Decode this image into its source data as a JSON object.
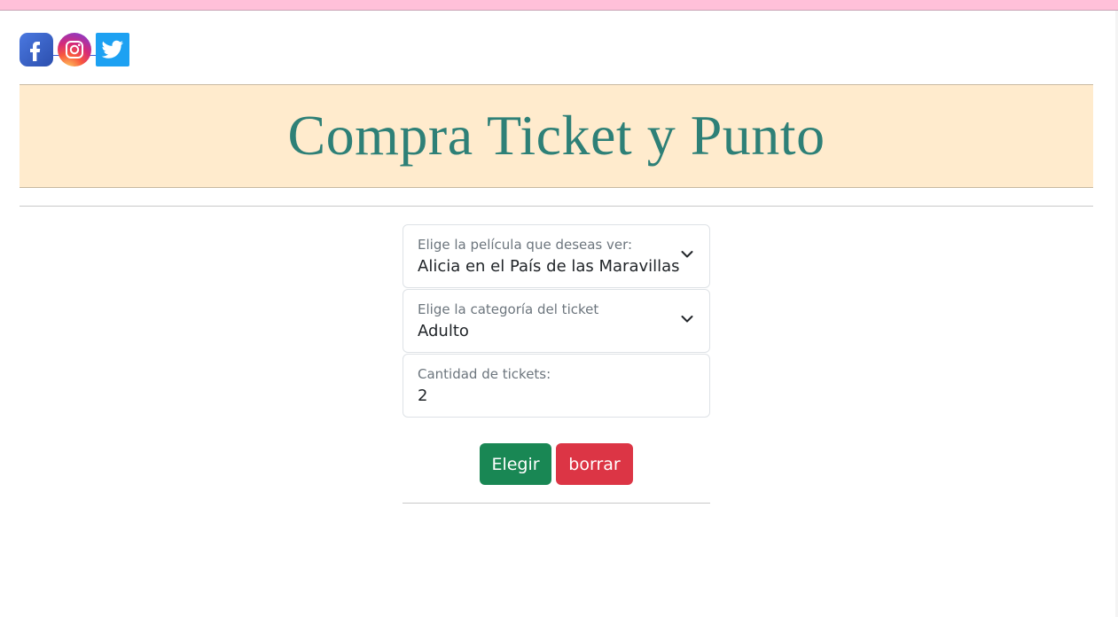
{
  "social": {
    "icons": [
      "facebook-icon",
      "instagram-icon",
      "twitter-icon"
    ],
    "colors": {
      "facebook": "#3b5bdb",
      "instagram": "#d62a78",
      "twitter": "#1da1f2"
    }
  },
  "header": {
    "title": "Compra Ticket y Punto"
  },
  "form": {
    "movie": {
      "label": "Elige la película que deseas ver:",
      "value": "Alicia en el País de las Maravillas"
    },
    "category": {
      "label": "Elige la categoría del ticket",
      "value": "Adulto"
    },
    "quantity": {
      "label": "Cantidad de tickets:",
      "value": "2"
    }
  },
  "actions": {
    "submit_label": "Elegir",
    "reset_label": "borrar"
  },
  "colors": {
    "top_strip": "#ffc0d9",
    "banner_bg": "#ffebcd",
    "title": "#2e8077",
    "submit": "#198754",
    "reset": "#dc3545"
  }
}
